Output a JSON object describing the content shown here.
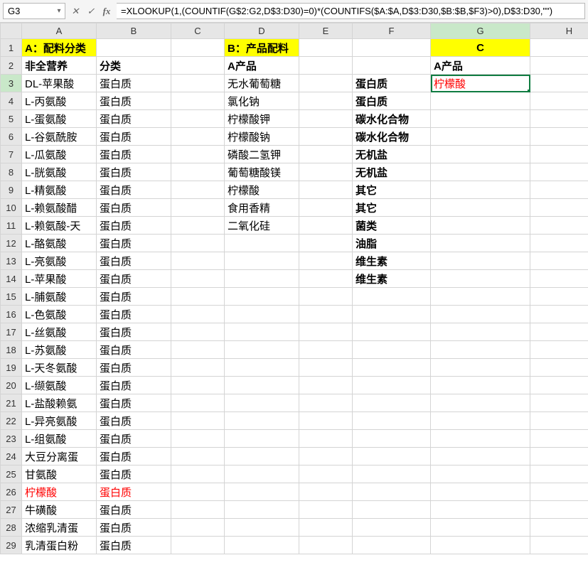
{
  "formula_bar": {
    "name_box_value": "G3",
    "cancel_icon": "✕",
    "accept_icon": "✓",
    "fx_icon": "fx",
    "formula_value": "=XLOOKUP(1,(COUNTIF(G$2:G2,D$3:D30)=0)*(COUNTIFS($A:$A,D$3:D30,$B:$B,$F3)>0),D$3:D30,\"\")"
  },
  "columns": [
    "A",
    "B",
    "C",
    "D",
    "E",
    "F",
    "G",
    "H"
  ],
  "active": {
    "col": "G",
    "row": 3,
    "cell_ref": "G3"
  },
  "rows": [
    {
      "n": 1,
      "A": "A：配料分类",
      "B": "",
      "C": "",
      "D": "B：产品配料",
      "E": "",
      "F": "",
      "G": "C",
      "H": ""
    },
    {
      "n": 2,
      "A": "非全营养",
      "B": "分类",
      "C": "",
      "D": "A产品",
      "E": "",
      "F": "",
      "G": "A产品",
      "H": ""
    },
    {
      "n": 3,
      "A": "DL-苹果酸",
      "B": "蛋白质",
      "C": "",
      "D": "无水葡萄糖",
      "E": "",
      "F": "蛋白质",
      "G": "柠檬酸",
      "H": ""
    },
    {
      "n": 4,
      "A": "L-丙氨酸",
      "B": "蛋白质",
      "C": "",
      "D": "氯化钠",
      "E": "",
      "F": "蛋白质",
      "G": "",
      "H": ""
    },
    {
      "n": 5,
      "A": "L-蛋氨酸",
      "B": "蛋白质",
      "C": "",
      "D": "柠檬酸钾",
      "E": "",
      "F": "碳水化合物",
      "G": "",
      "H": ""
    },
    {
      "n": 6,
      "A": "L-谷氨酰胺",
      "B": "蛋白质",
      "C": "",
      "D": "柠檬酸钠",
      "E": "",
      "F": "碳水化合物",
      "G": "",
      "H": ""
    },
    {
      "n": 7,
      "A": "L-瓜氨酸",
      "B": "蛋白质",
      "C": "",
      "D": "磷酸二氢钾",
      "E": "",
      "F": "无机盐",
      "G": "",
      "H": ""
    },
    {
      "n": 8,
      "A": "L-胱氨酸",
      "B": "蛋白质",
      "C": "",
      "D": "葡萄糖酸镁",
      "E": "",
      "F": "无机盐",
      "G": "",
      "H": ""
    },
    {
      "n": 9,
      "A": "L-精氨酸",
      "B": "蛋白质",
      "C": "",
      "D": "柠檬酸",
      "E": "",
      "F": "其它",
      "G": "",
      "H": ""
    },
    {
      "n": 10,
      "A": "L-赖氨酸醋",
      "B": "蛋白质",
      "C": "",
      "D": "食用香精",
      "E": "",
      "F": "其它",
      "G": "",
      "H": ""
    },
    {
      "n": 11,
      "A": "L-赖氨酸-天",
      "B": "蛋白质",
      "C": "",
      "D": "二氧化硅",
      "E": "",
      "F": "菌类",
      "G": "",
      "H": ""
    },
    {
      "n": 12,
      "A": "L-酪氨酸",
      "B": "蛋白质",
      "C": "",
      "D": "",
      "E": "",
      "F": "油脂",
      "G": "",
      "H": ""
    },
    {
      "n": 13,
      "A": "L-亮氨酸",
      "B": "蛋白质",
      "C": "",
      "D": "",
      "E": "",
      "F": "维生素",
      "G": "",
      "H": ""
    },
    {
      "n": 14,
      "A": "L-苹果酸",
      "B": "蛋白质",
      "C": "",
      "D": "",
      "E": "",
      "F": "维生素",
      "G": "",
      "H": ""
    },
    {
      "n": 15,
      "A": "L-脯氨酸",
      "B": "蛋白质",
      "C": "",
      "D": "",
      "E": "",
      "F": "",
      "G": "",
      "H": ""
    },
    {
      "n": 16,
      "A": "L-色氨酸",
      "B": "蛋白质",
      "C": "",
      "D": "",
      "E": "",
      "F": "",
      "G": "",
      "H": ""
    },
    {
      "n": 17,
      "A": "L-丝氨酸",
      "B": "蛋白质",
      "C": "",
      "D": "",
      "E": "",
      "F": "",
      "G": "",
      "H": ""
    },
    {
      "n": 18,
      "A": "L-苏氨酸",
      "B": "蛋白质",
      "C": "",
      "D": "",
      "E": "",
      "F": "",
      "G": "",
      "H": ""
    },
    {
      "n": 19,
      "A": "L-天冬氨酸",
      "B": "蛋白质",
      "C": "",
      "D": "",
      "E": "",
      "F": "",
      "G": "",
      "H": ""
    },
    {
      "n": 20,
      "A": "L-缬氨酸",
      "B": "蛋白质",
      "C": "",
      "D": "",
      "E": "",
      "F": "",
      "G": "",
      "H": ""
    },
    {
      "n": 21,
      "A": "L-盐酸赖氨",
      "B": "蛋白质",
      "C": "",
      "D": "",
      "E": "",
      "F": "",
      "G": "",
      "H": ""
    },
    {
      "n": 22,
      "A": "L-异亮氨酸",
      "B": "蛋白质",
      "C": "",
      "D": "",
      "E": "",
      "F": "",
      "G": "",
      "H": ""
    },
    {
      "n": 23,
      "A": "L-组氨酸",
      "B": "蛋白质",
      "C": "",
      "D": "",
      "E": "",
      "F": "",
      "G": "",
      "H": ""
    },
    {
      "n": 24,
      "A": "大豆分离蛋",
      "B": "蛋白质",
      "C": "",
      "D": "",
      "E": "",
      "F": "",
      "G": "",
      "H": ""
    },
    {
      "n": 25,
      "A": "甘氨酸",
      "B": "蛋白质",
      "C": "",
      "D": "",
      "E": "",
      "F": "",
      "G": "",
      "H": ""
    },
    {
      "n": 26,
      "A": "柠檬酸",
      "B": "蛋白质",
      "C": "",
      "D": "",
      "E": "",
      "F": "",
      "G": "",
      "H": ""
    },
    {
      "n": 27,
      "A": "牛磺酸",
      "B": "蛋白质",
      "C": "",
      "D": "",
      "E": "",
      "F": "",
      "G": "",
      "H": ""
    },
    {
      "n": 28,
      "A": "浓缩乳清蛋",
      "B": "蛋白质",
      "C": "",
      "D": "",
      "E": "",
      "F": "",
      "G": "",
      "H": ""
    },
    {
      "n": 29,
      "A": "乳清蛋白粉",
      "B": "蛋白质",
      "C": "",
      "D": "",
      "E": "",
      "F": "",
      "G": "",
      "H": ""
    }
  ],
  "styles": {
    "row1": {
      "A": "yellow bold",
      "D": "yellow bold",
      "G": "yellow bold center"
    },
    "row2": {
      "A": "bold",
      "B": "bold",
      "D": "bold",
      "G": "bold"
    },
    "row3": {
      "F": "bold",
      "G": "red"
    },
    "rowF_bold_from": 3,
    "rowF_bold_to": 14,
    "row26": {
      "A": "red",
      "B": "red"
    }
  },
  "glyphs": {
    "dropdown": "▾"
  }
}
